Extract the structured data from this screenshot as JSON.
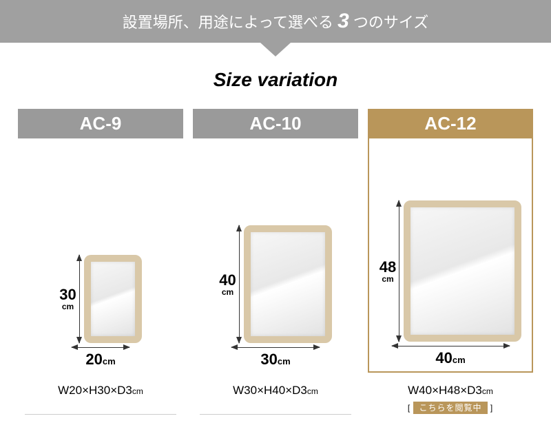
{
  "header": {
    "pre": "設置場所、用途によって選べる ",
    "num": "3",
    "post": " つのサイズ"
  },
  "subtitle": "Size variation",
  "variants": [
    {
      "label": "AC-9",
      "v_num": "30",
      "v_unit": "cm",
      "h_num": "20",
      "h_unit": "cm",
      "dims_pre": "W20×H30×D3",
      "dims_unit": "cm",
      "mirror_w": 84,
      "mirror_h": 128,
      "arrow_h": 128,
      "arrow_w": 84,
      "highlight": false
    },
    {
      "label": "AC-10",
      "v_num": "40",
      "v_unit": "cm",
      "h_num": "30",
      "h_unit": "cm",
      "dims_pre": "W30×H40×D3",
      "dims_unit": "cm",
      "mirror_w": 128,
      "mirror_h": 171,
      "arrow_h": 171,
      "arrow_w": 128,
      "highlight": false
    },
    {
      "label": "AC-12",
      "v_num": "48",
      "v_unit": "cm",
      "h_num": "40",
      "h_unit": "cm",
      "dims_pre": "W40×H48×D3",
      "dims_unit": "cm",
      "mirror_w": 171,
      "mirror_h": 205,
      "arrow_h": 205,
      "arrow_w": 171,
      "highlight": true
    }
  ],
  "viewing": {
    "bracket_open": "[ ",
    "label": "こちらを閲覧中",
    "bracket_close": " ]"
  }
}
